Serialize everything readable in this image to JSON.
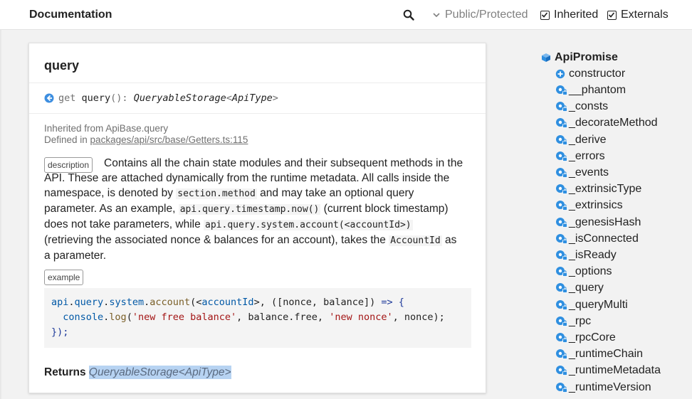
{
  "header": {
    "title": "Documentation",
    "visibility_label": "Public/Protected",
    "inherited_label": "Inherited",
    "externals_label": "Externals",
    "inherited_checked": true,
    "externals_checked": true
  },
  "member": {
    "title": "query",
    "signature": {
      "keyword": "get",
      "name": "query",
      "parens": "():",
      "type": "QueryableStorage",
      "generic_open": "<",
      "generic_type": "ApiType",
      "generic_close": ">"
    },
    "inherited_from_prefix": "Inherited from ",
    "inherited_from": "ApiBase.query",
    "defined_in_prefix": "Defined in ",
    "defined_in": "packages/api/src/base/Getters.ts:115",
    "description_tag": "description",
    "description": {
      "t1": "Contains all the chain state modules and their subsequent methods in the API. These are attached dynamically from the runtime metadata. All calls inside the namespace, is denoted by ",
      "c1": "section.method",
      "t2": " and may take an optional query parameter. As an example, ",
      "c2": "api.query.timestamp.now()",
      "t3": " (current block timestamp) does not take parameters, while ",
      "c3": "api.query.system.account(<accountId>)",
      "t4": " (retrieving the associated nonce & balances for an account), takes the ",
      "c4": "AccountId",
      "t5": " as a parameter."
    },
    "example_tag": "example",
    "example_code": {
      "l1_a": "api",
      "l1_b": ".",
      "l1_c": "query",
      "l1_d": ".",
      "l1_e": "system",
      "l1_f": ".",
      "l1_g": "account",
      "l1_h": "(<",
      "l1_i": "accountId",
      "l1_j": ">, ([nonce, balance]) ",
      "l1_k": "=>",
      "l1_l": " {",
      "l2_a": "  console",
      "l2_b": ".",
      "l2_c": "log",
      "l2_d": "(",
      "l2_e": "'new free balance'",
      "l2_f": ", balance.free, ",
      "l2_g": "'new nonce'",
      "l2_h": ", nonce);",
      "l3": "});"
    },
    "returns_label": "Returns",
    "returns_type": "QueryableStorage<ApiType>"
  },
  "sidebar": {
    "class_name": "ApiPromise",
    "constructor_label": "constructor",
    "items": [
      "__phantom",
      "_consts",
      "_decorateMethod",
      "_derive",
      "_errors",
      "_events",
      "_extrinsicType",
      "_extrinsics",
      "_genesisHash",
      "_isConnected",
      "_isReady",
      "_options",
      "_query",
      "_queryMulti",
      "_rpc",
      "_rpcCore",
      "_runtimeChain",
      "_runtimeMetadata",
      "_runtimeVersion"
    ]
  },
  "colors": {
    "accent": "#2f8fe0",
    "highlight": "#b7d3f2",
    "muted": "#707070"
  }
}
